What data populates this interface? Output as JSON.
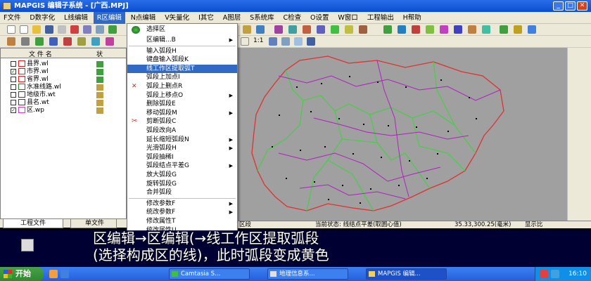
{
  "window": {
    "title": "MAPGIS 编辑子系统 - [广西.MPJ]",
    "min_label": "_",
    "max_label": "□",
    "close_label": "✕"
  },
  "menubar": [
    "F文件",
    "D数字化",
    "L线编辑",
    "R区编辑",
    "N点编辑",
    "V矢量化",
    "I其它",
    "A图层",
    "S系统库",
    "C检查",
    "O设置",
    "W窗口",
    "工程输出",
    "H帮助"
  ],
  "active_menu_index": 3,
  "toolbar2": {
    "zoom_label": "1:1"
  },
  "left_panel": {
    "headers": [
      "文 件 名",
      "状"
    ],
    "files": [
      {
        "name": "县界.wl",
        "checked": false,
        "icon_color": "#e02020"
      },
      {
        "name": "市界.wl",
        "checked": true,
        "icon_color": "#e02020"
      },
      {
        "name": "省界.wl",
        "checked": false,
        "icon_color": "#e02020"
      },
      {
        "name": "水准线路.wl",
        "checked": false,
        "icon_color": "#208020"
      },
      {
        "name": "地级市.wt",
        "checked": false,
        "icon_color": "#404040"
      },
      {
        "name": "县名.wt",
        "checked": false,
        "icon_color": "#404040"
      },
      {
        "name": "区.wp",
        "checked": true,
        "icon_color": "#c040c0"
      }
    ],
    "tabs": [
      "工程文件",
      "单文件"
    ]
  },
  "dropdown": {
    "top_item": "选择区",
    "items": [
      {
        "label": "区编辑...B",
        "arrow": true,
        "sep_after": true
      },
      {
        "label": "输入弧段H",
        "arrow": false
      },
      {
        "label": "键盘输入弧段K",
        "arrow": false
      },
      {
        "label": "线工作区提取弧T",
        "arrow": false,
        "highlight": true
      },
      {
        "label": "弧段上加点I",
        "arrow": false
      },
      {
        "label": "弧段上删点R",
        "arrow": false
      },
      {
        "label": "弧段上移点O",
        "arrow": true
      },
      {
        "label": "删除弧段E",
        "arrow": false
      },
      {
        "label": "移动弧段M",
        "arrow": true
      },
      {
        "label": "剪断弧段C",
        "arrow": false
      },
      {
        "label": "弧段改向A",
        "arrow": false
      },
      {
        "label": "延长缩短弧段N",
        "arrow": true
      },
      {
        "label": "光滑弧段H",
        "arrow": true
      },
      {
        "label": "弧段抽稀I",
        "arrow": false
      },
      {
        "label": "弧段结点平差G",
        "arrow": true
      },
      {
        "label": "放大弧段G",
        "arrow": false
      },
      {
        "label": "旋转弧段G",
        "arrow": false
      },
      {
        "label": "合并弧段",
        "arrow": false,
        "sep_after": true
      },
      {
        "label": "修改参数F",
        "arrow": true
      },
      {
        "label": "统改参数F",
        "arrow": true
      },
      {
        "label": "修改属性T",
        "arrow": false
      },
      {
        "label": "统改属性U",
        "arrow": false
      }
    ]
  },
  "statusbar": {
    "left": "区段",
    "state": "当前状态: 线结点平差(取圆心值)",
    "coords": "35.33,300.25(毫米)",
    "right": "显示比"
  },
  "subtitle": {
    "line1": "区编辑→区编辑(→线工作区提取弧段",
    "line2": "(选择构成区的线)，此时弧段变成黄色"
  },
  "taskbar": {
    "start": "开始",
    "tasks": [
      "Camtasia S...",
      "地理信息系...",
      "MAPGIS 编辑..."
    ],
    "clock": "16:10"
  },
  "colors": {
    "map_bg": "#a0a0a0",
    "boundary_red": "#e03030",
    "boundary_green": "#30d030",
    "boundary_magenta": "#b020c0",
    "highlight": "#316ac5"
  }
}
